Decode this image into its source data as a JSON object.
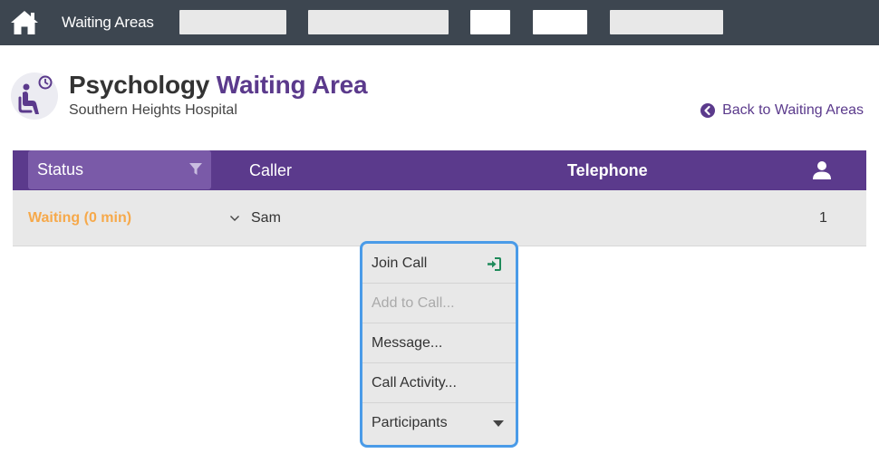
{
  "nav": {
    "title": "Waiting Areas",
    "home_icon": "home-icon"
  },
  "header": {
    "title_main": "Psychology",
    "title_accent": "Waiting Area",
    "subtitle": "Southern Heights Hospital",
    "back_link": "Back to Waiting Areas",
    "accent_color": "#5b3a8c"
  },
  "table": {
    "columns": {
      "status": "Status",
      "caller": "Caller",
      "telephone": "Telephone"
    },
    "rows": [
      {
        "status": "Waiting (0 min)",
        "caller": "Sam",
        "telephone": "",
        "participants": "1"
      }
    ],
    "status_color": "#f6a94b"
  },
  "menu": {
    "items": [
      {
        "label": "Join Call",
        "enabled": true
      },
      {
        "label": "Add to Call...",
        "enabled": false
      },
      {
        "label": "Message...",
        "enabled": true
      },
      {
        "label": "Call Activity...",
        "enabled": true
      },
      {
        "label": "Participants",
        "enabled": true
      }
    ]
  }
}
